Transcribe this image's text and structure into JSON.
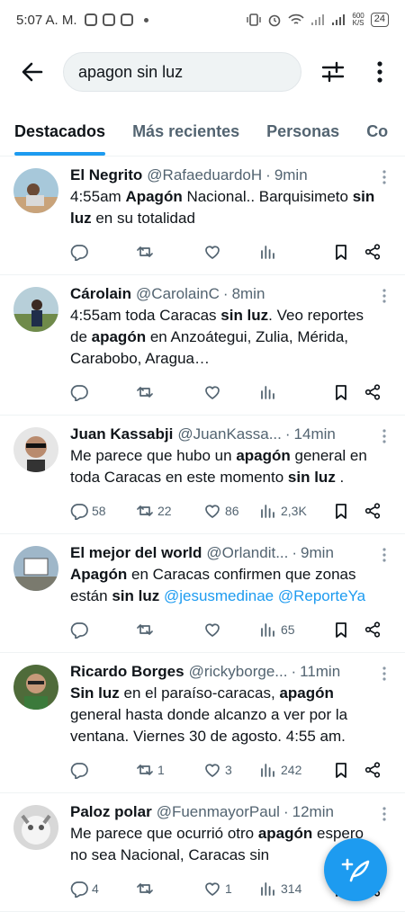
{
  "status_bar": {
    "time": "5:07 A. M.",
    "speed_top": "600",
    "speed_bottom": "K/S",
    "battery": "24"
  },
  "header": {
    "search_value": "apagon sin luz",
    "back_icon": "arrow-left-icon",
    "filter_icon": "sliders-icon",
    "more_icon": "vertical-dots-icon"
  },
  "tabs": [
    {
      "label": "Destacados",
      "active": true
    },
    {
      "label": "Más recientes",
      "active": false
    },
    {
      "label": "Personas",
      "active": false
    },
    {
      "label": "Co",
      "active": false
    }
  ],
  "tweets": [
    {
      "name": "El Negrito",
      "handle": "@RafaeduardoH",
      "sep": "·",
      "time": "9min",
      "text_parts": [
        {
          "t": "4:55am "
        },
        {
          "t": "Apagón",
          "b": true
        },
        {
          "t": " Nacional.. Barquisimeto "
        },
        {
          "t": "sin luz",
          "b": true
        },
        {
          "t": " en su totalidad"
        }
      ],
      "replies": "",
      "retweets": "",
      "likes": "",
      "views": ""
    },
    {
      "name": "Cárolain",
      "handle": "@CarolainC",
      "sep": "·",
      "time": "8min",
      "text_parts": [
        {
          "t": "4:55am toda Caracas "
        },
        {
          "t": "sin luz",
          "b": true
        },
        {
          "t": ". Veo reportes de "
        },
        {
          "t": "apagón",
          "b": true
        },
        {
          "t": " en Anzoátegui, Zulia, Mérida, Carabobo, Aragua…"
        }
      ],
      "replies": "",
      "retweets": "",
      "likes": "",
      "views": ""
    },
    {
      "name": "Juan Kassabji",
      "handle": "@JuanKassa...",
      "sep": "·",
      "time": "14min",
      "text_parts": [
        {
          "t": "Me parece que hubo un "
        },
        {
          "t": "apagón",
          "b": true
        },
        {
          "t": " general en toda Caracas en este momento "
        },
        {
          "t": "sin luz",
          "b": true
        },
        {
          "t": " ."
        }
      ],
      "replies": "58",
      "retweets": "22",
      "likes": "86",
      "views": "2,3K"
    },
    {
      "name": "El mejor del world",
      "handle": "@Orlandit...",
      "sep": "·",
      "time": "9min",
      "text_parts": [
        {
          "t": "Apagón",
          "b": true
        },
        {
          "t": " en Caracas confirmen que zonas están "
        },
        {
          "t": "sin luz",
          "b": true
        },
        {
          "t": " "
        },
        {
          "t": "@jesusmedinae",
          "link": true
        },
        {
          "t": " "
        },
        {
          "t": "@ReporteYa",
          "link": true
        }
      ],
      "replies": "",
      "retweets": "",
      "likes": "",
      "views": "65"
    },
    {
      "name": "Ricardo Borges",
      "handle": "@rickyborge...",
      "sep": "·",
      "time": "11min",
      "text_parts": [
        {
          "t": "Sin luz",
          "b": true
        },
        {
          "t": " en el paraíso-caracas, "
        },
        {
          "t": "apagón",
          "b": true
        },
        {
          "t": " general hasta donde alcanzo a ver por la ventana. Viernes 30 de agosto. 4:55 am."
        }
      ],
      "replies": "",
      "retweets": "1",
      "likes": "3",
      "views": "242"
    },
    {
      "name": "Paloz polar",
      "handle": "@FuenmayorPaul",
      "sep": "·",
      "time": "12min",
      "text_parts": [
        {
          "t": "Me parece que ocurrió otro "
        },
        {
          "t": "apagón",
          "b": true
        },
        {
          "t": " espero no sea Nacional, Caracas sin"
        }
      ],
      "replies": "4",
      "retweets": "",
      "likes": "1",
      "views": "314"
    }
  ],
  "fab": {
    "icon": "compose-feather-plus-icon"
  },
  "colors": {
    "accent": "#1d9bf0",
    "text": "#0f1419",
    "secondary": "#536471"
  }
}
